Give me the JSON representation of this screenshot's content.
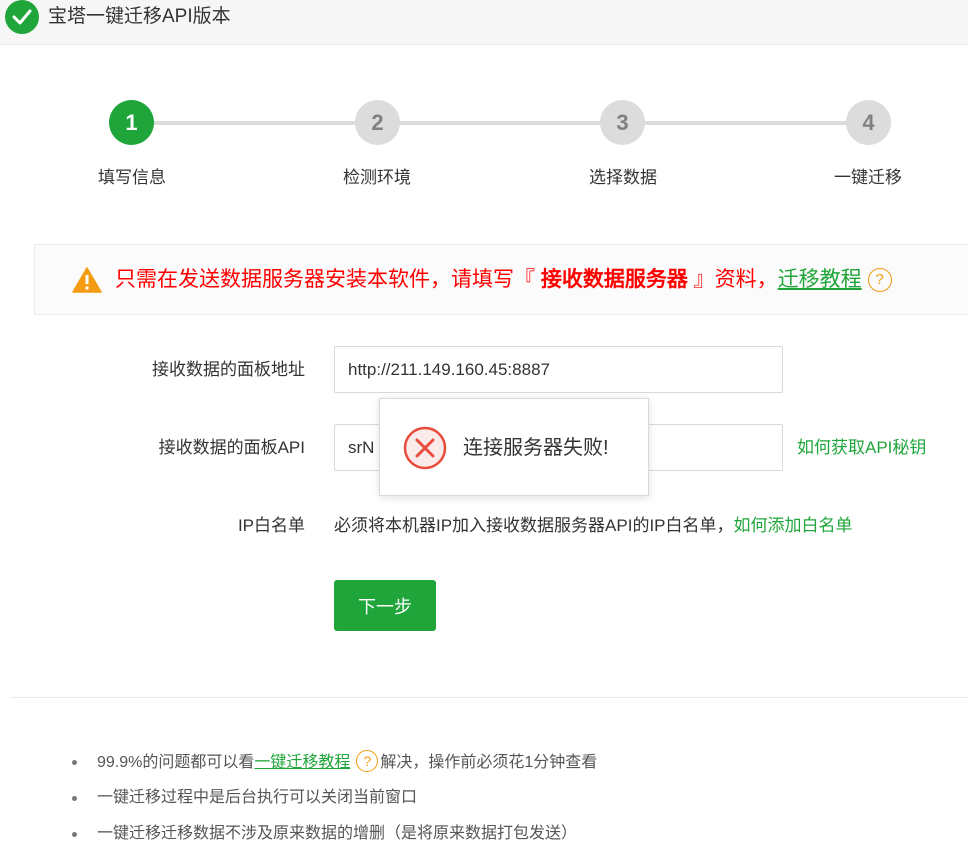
{
  "window": {
    "title": "宝塔一键迁移API版本"
  },
  "steps": [
    {
      "number": "1",
      "label": "填写信息"
    },
    {
      "number": "2",
      "label": "检测环境"
    },
    {
      "number": "3",
      "label": "选择数据"
    },
    {
      "number": "4",
      "label": "一键迁移"
    }
  ],
  "notice": {
    "prefix": "只需在发送数据服务器安装本软件，请填写『 ",
    "highlight": "接收数据服务器",
    "suffix": " 』资料，",
    "link": "迁移教程",
    "help": "?"
  },
  "form": {
    "panel_url_label": "接收数据的面板地址",
    "panel_url_value": "http://211.149.160.45:8887",
    "api_label": "接收数据的面板API",
    "api_value": "srN                                        eVr",
    "api_help_link": "如何获取API秘钥",
    "ip_label": "IP白名单",
    "ip_note": "必须将本机器IP加入接收数据服务器API的IP白名单，",
    "ip_link": "如何添加白名单",
    "next_button": "下一步"
  },
  "toast": {
    "message": "连接服务器失败!"
  },
  "tips": {
    "item1_prefix": "99.9%的问题都可以看",
    "item1_link": "一键迁移教程",
    "item1_help": "?",
    "item1_suffix": "解决，操作前必须花1分钟查看",
    "item2": "一键迁移过程中是后台执行可以关闭当前窗口",
    "item3": "一键迁移迁移数据不涉及原来数据的增删（是将原来数据打包发送）"
  },
  "colors": {
    "accent": "#20a53a",
    "warning": "#f39c12",
    "error": "#ff0000",
    "toast_error": "#e74c3c"
  }
}
